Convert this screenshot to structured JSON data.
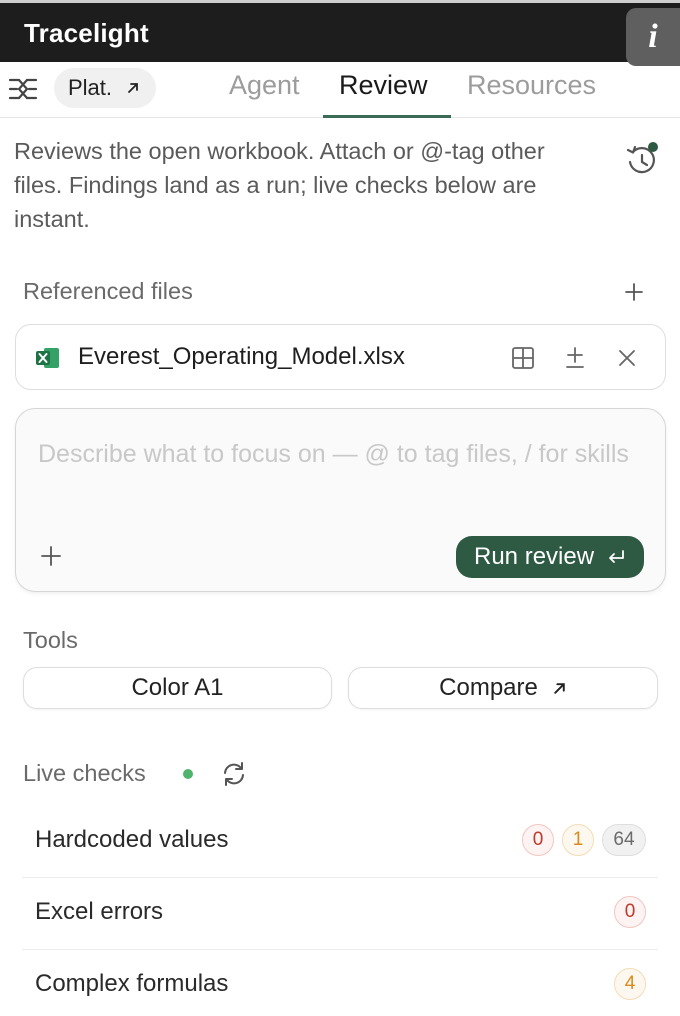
{
  "app": {
    "title": "Tracelight"
  },
  "tabs": {
    "plat_label": "Plat.",
    "items": [
      "Agent",
      "Review",
      "Resources"
    ],
    "active": "Review",
    "info_glyph": "i"
  },
  "description": "Reviews the open workbook. Attach or @-tag other files. Findings land as a run; live checks below are instant.",
  "referenced_files": {
    "label": "Referenced files",
    "files": [
      {
        "name": "Everest_Operating_Model.xlsx",
        "type": "excel"
      }
    ]
  },
  "prompt": {
    "placeholder": "Describe what to focus on — @ to tag files, / for skills",
    "run_label": "Run review"
  },
  "tools": {
    "label": "Tools",
    "buttons": [
      "Color A1",
      "Compare"
    ]
  },
  "live_checks": {
    "label": "Live checks",
    "rows": [
      {
        "label": "Hardcoded values",
        "red": "0",
        "orange": "1",
        "gray": "64"
      },
      {
        "label": "Excel errors",
        "red": "0"
      },
      {
        "label": "Complex formulas",
        "orange": "4"
      }
    ]
  },
  "colors": {
    "accent": "#2e5a43",
    "live": "#4fb36d",
    "error": "#c0392b",
    "warning": "#d98a1c"
  },
  "icons": [
    "close-icon",
    "menu-icon",
    "external-link-icon",
    "info-icon",
    "history-icon",
    "plus-icon",
    "excel-file-icon",
    "table-view-icon",
    "plus-minus-icon",
    "remove-icon",
    "enter-icon",
    "refresh-icon"
  ]
}
